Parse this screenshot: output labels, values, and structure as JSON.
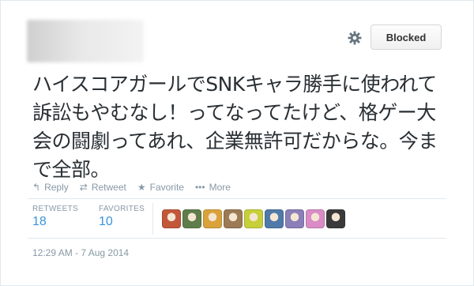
{
  "header": {
    "blocked_label": "Blocked"
  },
  "tweet": {
    "text": "ハイスコアガールでSNKキャラ勝手に使われて訴訟もやむなし！ってなってたけど、格ゲー大会の闘劇ってあれ、企業無許可だからな。今まで全部。"
  },
  "actions": {
    "reply": "Reply",
    "retweet": "Retweet",
    "favorite": "Favorite",
    "more": "More"
  },
  "stats": {
    "retweets_label": "RETWEETS",
    "retweets_value": "18",
    "favorites_label": "FAVORITES",
    "favorites_value": "10"
  },
  "favoriters": [
    {
      "color": "#c2573a"
    },
    {
      "color": "#5f7d4b"
    },
    {
      "color": "#d9a23b"
    },
    {
      "color": "#9b7a55"
    },
    {
      "color": "#c7cf3a"
    },
    {
      "color": "#4f79a8"
    },
    {
      "color": "#8a7fb8"
    },
    {
      "color": "#d98cc5"
    },
    {
      "color": "#3a3a3a"
    }
  ],
  "timestamp": "12:29 AM - 7 Aug 2014",
  "colors": {
    "link": "#3b94d9",
    "muted": "#8899a6",
    "text": "#292f33"
  }
}
